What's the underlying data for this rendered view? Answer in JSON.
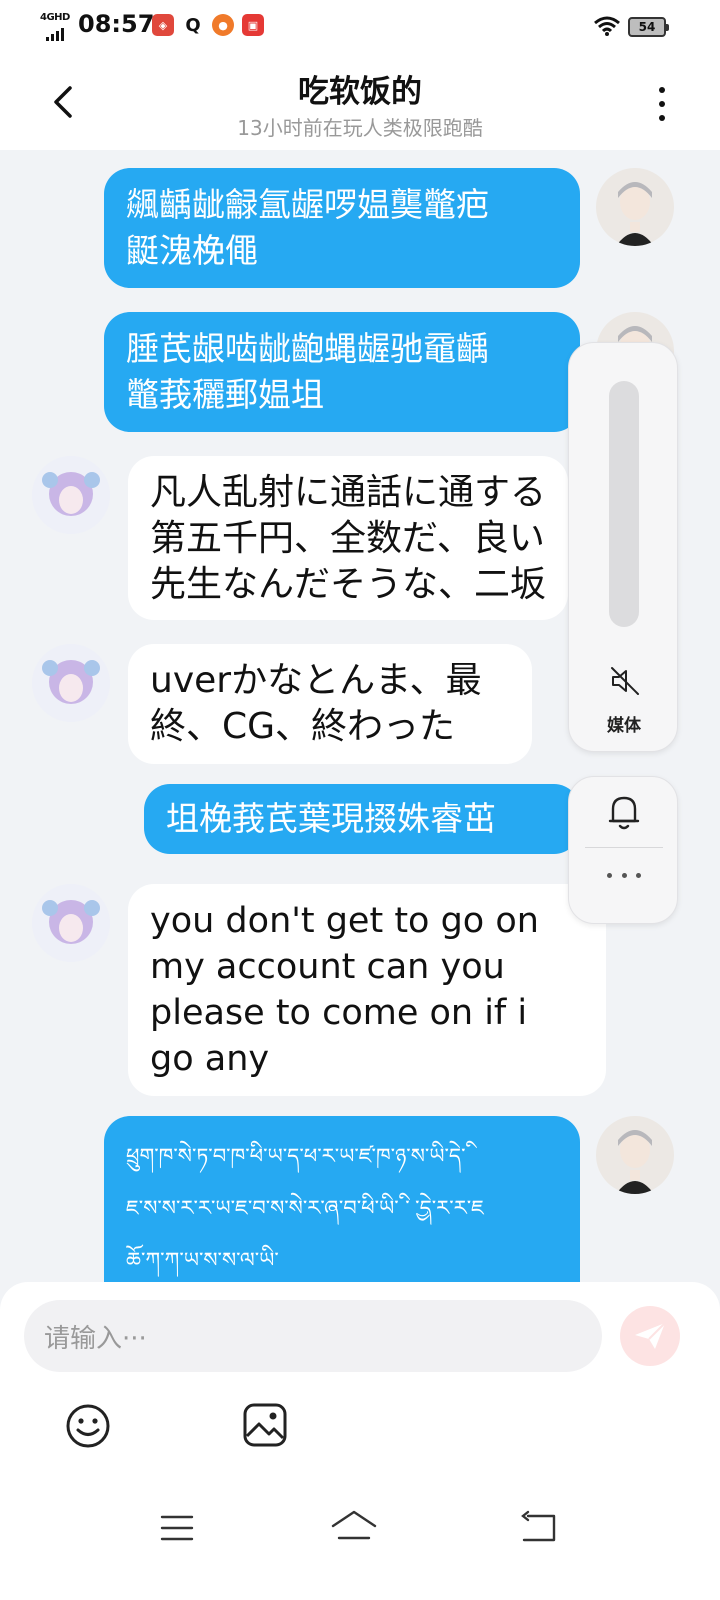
{
  "status_bar": {
    "network": "4GHD",
    "time": "08:57",
    "battery": "54",
    "app_icons": [
      "app-red-icon",
      "search-app-icon",
      "game-app-icon",
      "shop-app-icon"
    ]
  },
  "header": {
    "title": "吃软饭的",
    "subtitle": "13小时前在玩人类极限跑酷"
  },
  "messages": [
    {
      "direction": "sent",
      "lines": [
        "飊齲龇龣氲龌啰媪龑鼈疤",
        "鼮溾梚僶"
      ]
    },
    {
      "direction": "sent",
      "lines": [
        "腄芪龈啮龇齙蝿龌驰黿齲",
        "鼈莪穲郵媪坥"
      ]
    },
    {
      "direction": "received",
      "lines": [
        "凡人乱射に通話に通する",
        "第五千円、全数だ、良い",
        "先生なんだそうな、二坂"
      ]
    },
    {
      "direction": "received",
      "lines": [
        "uverかなとんま、最",
        "終、CG、終わった"
      ]
    },
    {
      "direction": "sent",
      "lines": [
        "坥梚莪芪葉現掇姝睿茁"
      ]
    },
    {
      "direction": "received",
      "lines": [
        "you don't get to go on",
        "my account can you",
        "please to come on if i",
        "go any"
      ]
    },
    {
      "direction": "sent",
      "lines": [
        "ཕྲུག་ཁ་སེ་ཏ་བ་ཁ་ཕི་ཡ་ད་ཕ་ར་ཡ་ཛ་ཁ་ཉ་ས་ཡི་དེ་ི",
        "ཇ་ས་ས་ར་ར་ཡ་ཇ་བ་ས་སེ་ར་ཞ་བ་ཕི་ཡི་ི ་ ྱ་དེ་ར་ར་ཇ",
        "ཆོ་ཀ་ཀ་ཡ་ས་ས་ལ་ཡི་"
      ]
    }
  ],
  "side_panel": {
    "media_label": "媒体",
    "volume_level": 0
  },
  "input": {
    "placeholder": "请输入···"
  },
  "colors": {
    "sent_bubble": "#26a9f2",
    "received_bubble": "#ffffff",
    "background": "#f1f3f6",
    "send_button": "#fde3e3"
  }
}
